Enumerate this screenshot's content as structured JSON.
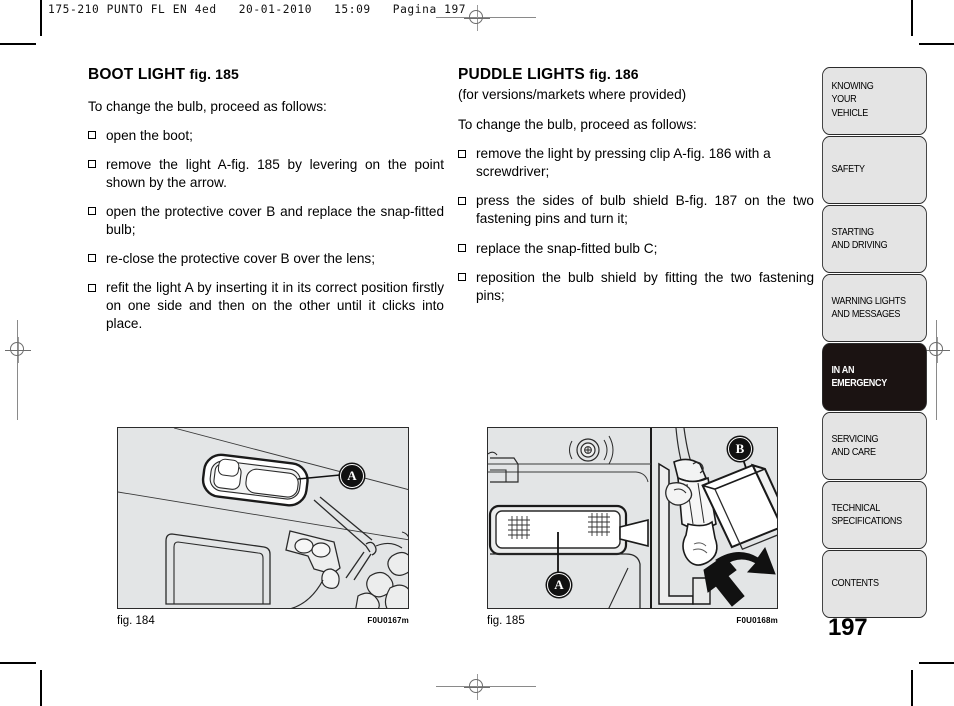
{
  "print_slug": "175-210 PUNTO FL EN 4ed   20-01-2010   15:09   Pagina 197",
  "page_number": "197",
  "left_column": {
    "title": "BOOT LIGHT",
    "title_fig": "fig. 185",
    "lead": "To change the bulb, proceed as follows:",
    "steps": [
      "open the boot;",
      "remove the light A-fig. 185 by levering on the point shown by the arrow.",
      "open the protective cover B and replace the snap-fitted bulb;",
      "re-close the protective cover B over the lens;",
      "refit the light A by inserting it in its correct position firstly on one side and then on the other until it clicks into place."
    ]
  },
  "right_column": {
    "title": "PUDDLE LIGHTS",
    "title_fig": "fig. 186",
    "subtitle": "(for versions/markets where provided)",
    "lead": "To change the bulb, proceed as follows:",
    "steps": [
      "remove the light by pressing clip A-fig. 186 with a screwdriver;",
      "press the sides of bulb shield B-fig. 187 on the two fastening pins and turn it;",
      "replace the snap-fitted bulb C;",
      "reposition the bulb shield by fitting the two fastening pins;"
    ]
  },
  "figures": [
    {
      "caption": "fig. 184",
      "code": "F0U0167m",
      "callouts": [
        "A"
      ]
    },
    {
      "caption": "fig. 185",
      "code": "F0U0168m",
      "callouts": [
        "A",
        "B"
      ]
    }
  ],
  "sidebar": {
    "tabs": [
      {
        "lines": [
          "KNOWING",
          "YOUR",
          "VEHICLE"
        ],
        "active": false
      },
      {
        "lines": [
          "SAFETY"
        ],
        "active": false
      },
      {
        "lines": [
          "STARTING",
          "AND DRIVING"
        ],
        "active": false
      },
      {
        "lines": [
          "WARNING LIGHTS",
          "AND MESSAGES"
        ],
        "active": false
      },
      {
        "lines": [
          "IN AN",
          "EMERGENCY"
        ],
        "active": true
      },
      {
        "lines": [
          "SERVICING",
          "AND CARE"
        ],
        "active": false
      },
      {
        "lines": [
          "TECHNICAL",
          "SPECIFICATIONS"
        ],
        "active": false
      },
      {
        "lines": [
          "CONTENTS"
        ],
        "active": false
      }
    ]
  },
  "colors": {
    "active_tab_bg": "#1b1312",
    "tab_bg": "#e4e4e4",
    "figure_bg": "#e3e5e6",
    "ink": "#000000"
  }
}
